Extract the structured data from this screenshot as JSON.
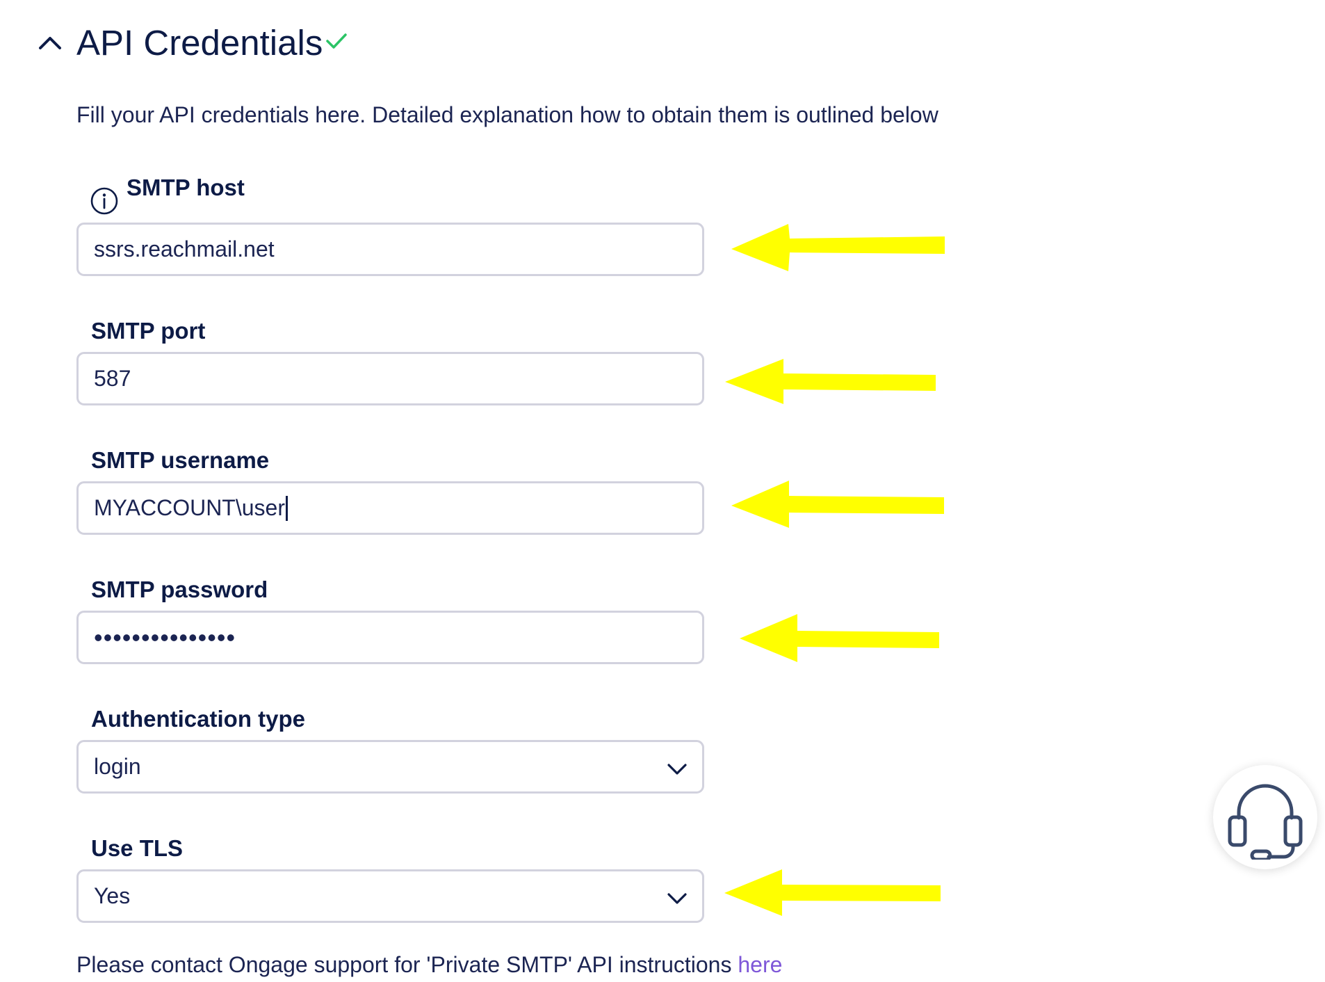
{
  "section": {
    "title": "API Credentials",
    "description": "Fill your API credentials here. Detailed explanation how to obtain them is outlined below",
    "status_icon": "check-icon",
    "collapse_icon": "chevron-up-icon"
  },
  "fields": {
    "smtp_host": {
      "label": "SMTP host",
      "value": "ssrs.reachmail.net",
      "icon": "info-icon"
    },
    "smtp_port": {
      "label": "SMTP port",
      "value": "587"
    },
    "smtp_username": {
      "label": "SMTP username",
      "value": "MYACCOUNT\\user"
    },
    "smtp_password": {
      "label": "SMTP password",
      "value": "•••••••••••••••"
    },
    "auth_type": {
      "label": "Authentication type",
      "value": "login",
      "icon": "chevron-down-icon"
    },
    "use_tls": {
      "label": "Use TLS",
      "value": "Yes",
      "icon": "chevron-down-icon"
    }
  },
  "footer": {
    "text": "Please contact Ongage support for 'Private SMTP' API instructions ",
    "link": "here"
  },
  "support": {
    "icon": "headset-icon"
  },
  "colors": {
    "text": "#0d1b46",
    "check": "#2bc466",
    "link": "#7e57d8",
    "field_border": "#d2d2de",
    "annotation_arrow": "#ffff00"
  }
}
